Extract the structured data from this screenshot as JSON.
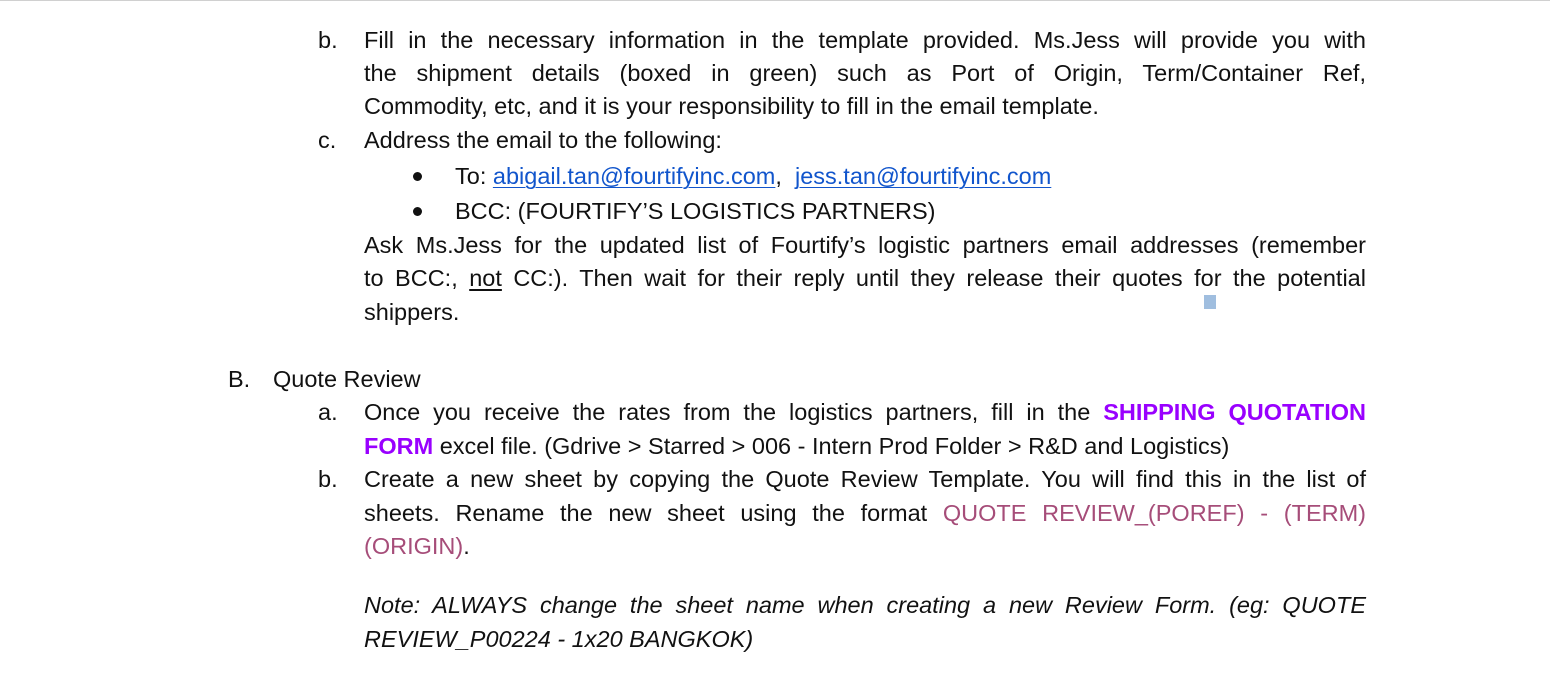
{
  "section_a_items": {
    "b": {
      "marker": "b.",
      "line1": "Fill in the necessary information in the template provided. Ms.Jess will provide you with",
      "line2": "the shipment details (boxed in green) such as Port of Origin, Term/Container Ref,",
      "line3": "Commodity, etc, and it is your responsibility to fill in the email template."
    },
    "c": {
      "marker": "c.",
      "text": "Address the email to the following:",
      "bullets": [
        {
          "prefix": "To: ",
          "link1": "abigail.tan@fourtifyinc.com",
          "sep": ",  ",
          "link2": "jess.tan@fourtifyinc.com"
        },
        {
          "text": "BCC: (FOURTIFY’S LOGISTICS PARTNERS)"
        }
      ],
      "para_line1": "Ask Ms.Jess for the updated list of Fourtify’s logistic partners email addresses (remember",
      "para_line2_a": "to BCC:, ",
      "para_line2_not": "not",
      "para_line2_b": " CC:). Then wait for their reply until they release their quotes f",
      "para_line2_c": "or the potential",
      "para_line3": "shippers."
    }
  },
  "section_b": {
    "marker": "B.",
    "title": "Quote Review",
    "a": {
      "marker": "a.",
      "line1_a": "Once you receive the rates from the logistics partners, fill in the ",
      "line1_highlight": "SHIPPING QUOTATION",
      "line2_highlight": "FORM",
      "line2_rest": " excel file. (Gdrive > Starred > 006 - Intern Prod Folder > R&D and Logistics)"
    },
    "b": {
      "marker": "b.",
      "line1": "Create a new sheet by copying the Quote Review Template. You will find this in the list of",
      "line2_a": "sheets. Rename the new sheet using the format ",
      "line2_format": "QUOTE REVIEW_(POREF) - (TERM)",
      "line3_format": "(ORIGIN)",
      "line3_end": "."
    },
    "note_line1": "Note: ALWAYS change the sheet name when creating a new Review Form. (eg: QUOTE",
    "note_line2": "REVIEW_P00224 - 1x20 BANGKOK)"
  },
  "colors": {
    "link": "#1155cc",
    "highlight_purple": "#9900ff",
    "format_mauve": "#a64d79"
  }
}
